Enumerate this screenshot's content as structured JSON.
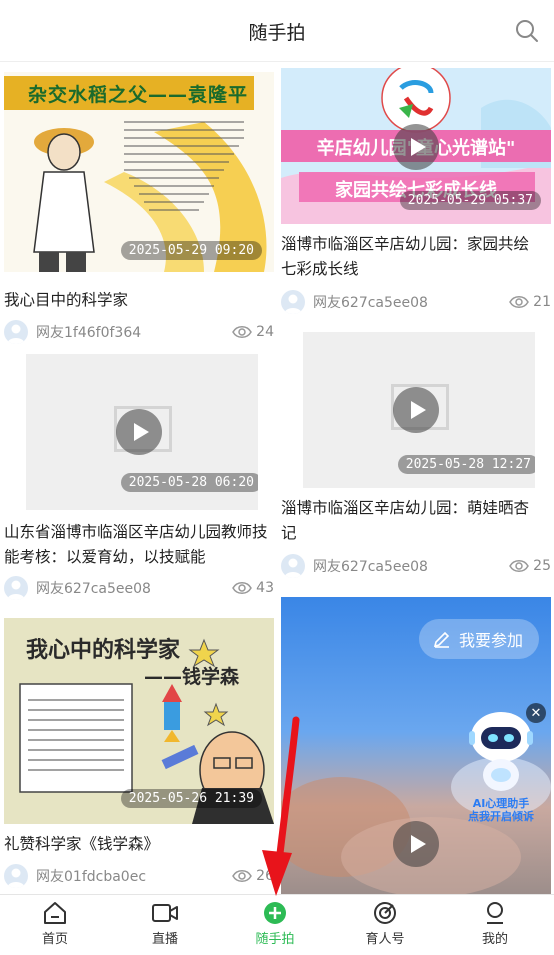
{
  "header": {
    "title": "随手拍",
    "search_icon": "search-icon"
  },
  "cards": [
    {
      "date": "2025-05-29 09:20",
      "caption": "我心目中的科学家",
      "author": "网友1f46f0f364",
      "views": "24",
      "thumb_title": "杂交水稻之父——袁隆平"
    },
    {
      "date": "2025-05-29 05:37",
      "caption": "淄博市临淄区辛店幼儿园：家园共绘七彩成长线",
      "author": "网友627ca5ee08",
      "views": "21",
      "banner_line1": "辛店幼儿园\"童心光谱站\"",
      "banner_line2": "家园共绘七彩成长线"
    },
    {
      "date": "2025-05-28 06:20",
      "caption": "山东省淄博市临淄区辛店幼儿园教师技能考核：以爱育幼，以技赋能",
      "author": "网友627ca5ee08",
      "views": "43"
    },
    {
      "date": "2025-05-28 12:27",
      "caption": "淄博市临淄区辛店幼儿园：萌娃晒杏记",
      "author": "网友627ca5ee08",
      "views": "25"
    },
    {
      "date": "2025-05-26 21:39",
      "caption": "礼赞科学家《钱学森》",
      "author": "网友01fdcba0ec",
      "views": "26",
      "thumb_title": "我心中的科学家",
      "thumb_subtitle": "——钱学森"
    },
    {
      "join_label": "我要参加",
      "robot_caption": "AI心理助手\n点我开启倾诉"
    }
  ],
  "tabbar": {
    "tabs": [
      {
        "label": "首页",
        "icon": "home-icon"
      },
      {
        "label": "直播",
        "icon": "video-camera-icon"
      },
      {
        "label": "随手拍",
        "icon": "plus-circle-icon"
      },
      {
        "label": "育人号",
        "icon": "target-icon"
      },
      {
        "label": "我的",
        "icon": "user-icon"
      }
    ],
    "active_index": 2
  },
  "colors": {
    "accent": "#2dbb55",
    "annotation_arrow": "#e8141b"
  }
}
